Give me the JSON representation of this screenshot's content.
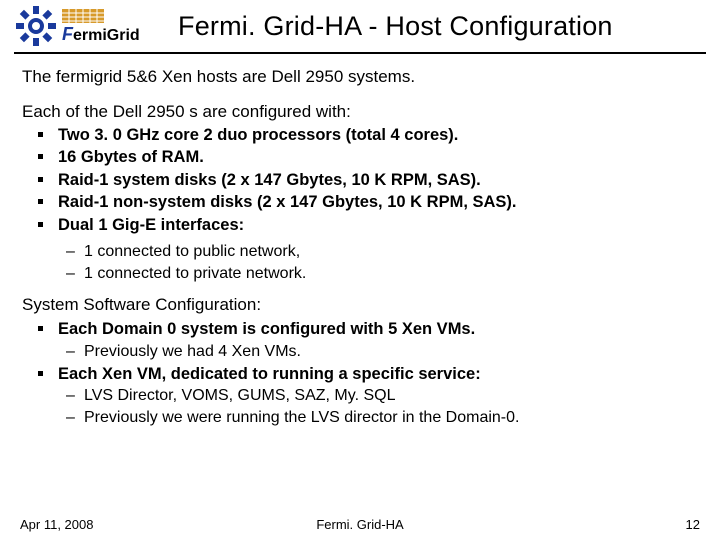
{
  "header": {
    "logo_text": "ermiGrid",
    "title": "Fermi. Grid-HA - Host Configuration"
  },
  "body": {
    "p1": "The fermigrid 5&6 Xen hosts are Dell 2950 systems.",
    "p2": "Each of the Dell 2950 s are configured with:",
    "hw": [
      "Two 3. 0 GHz core 2 duo processors (total 4 cores).",
      "16 Gbytes of RAM.",
      "Raid-1 system disks (2 x 147 Gbytes, 10 K RPM, SAS).",
      "Raid-1 non-system disks (2 x 147 Gbytes, 10 K RPM, SAS).",
      "Dual 1 Gig-E interfaces:"
    ],
    "hw_sub": [
      "1 connected to public network,",
      "1 connected to private network."
    ],
    "p3": "System Software Configuration:",
    "sw1": "Each Domain 0 system is configured with 5 Xen VMs.",
    "sw1_sub": [
      "Previously we had 4 Xen VMs."
    ],
    "sw2": "Each Xen VM, dedicated to running a specific service:",
    "sw2_sub": [
      "LVS Director, VOMS, GUMS, SAZ, My. SQL",
      "Previously we were running the LVS director in the Domain-0."
    ]
  },
  "footer": {
    "left": "Apr 11, 2008",
    "center": "Fermi. Grid-HA",
    "right": "12"
  }
}
